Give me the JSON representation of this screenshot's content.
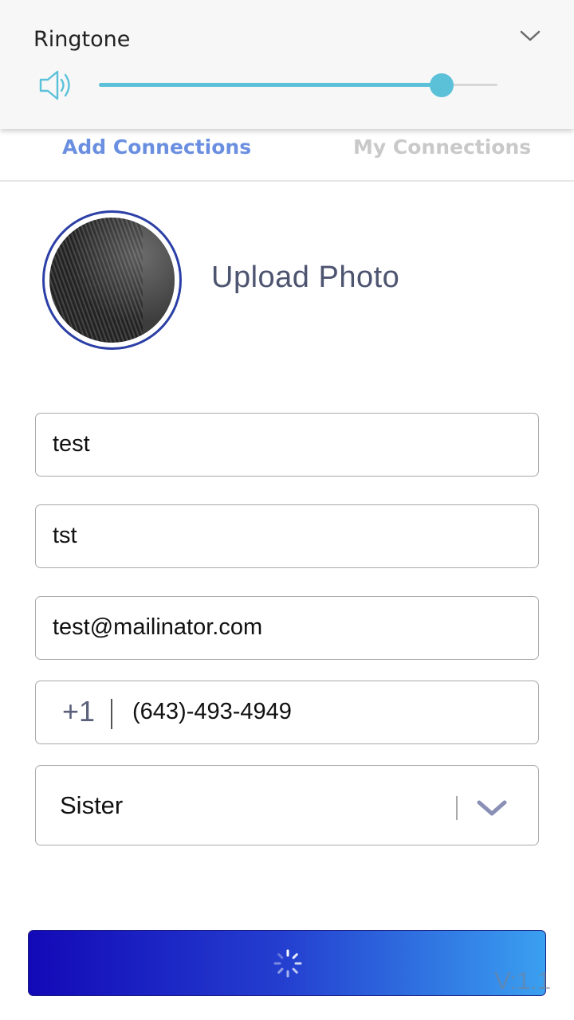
{
  "volume_panel": {
    "title": "Ringtone",
    "volume_level": 0.86,
    "accent_color": "#5bc1d9",
    "icons": [
      "speaker-icon",
      "chevron-down-icon"
    ]
  },
  "tabs": [
    {
      "label": "Add Connections",
      "active": true
    },
    {
      "label": "My Connections",
      "active": false
    }
  ],
  "photo": {
    "upload_label": "Upload Photo"
  },
  "form": {
    "first_name": "test",
    "last_name": "tst",
    "email": "test@mailinator.com",
    "country_code": "+1",
    "phone": "(643)-493-4949",
    "relationship": "Sister"
  },
  "submit": {
    "state": "loading",
    "icon": "spinner-icon",
    "gradient": [
      "#1309b7",
      "#3aa0f0"
    ]
  },
  "version": "V:1.1"
}
